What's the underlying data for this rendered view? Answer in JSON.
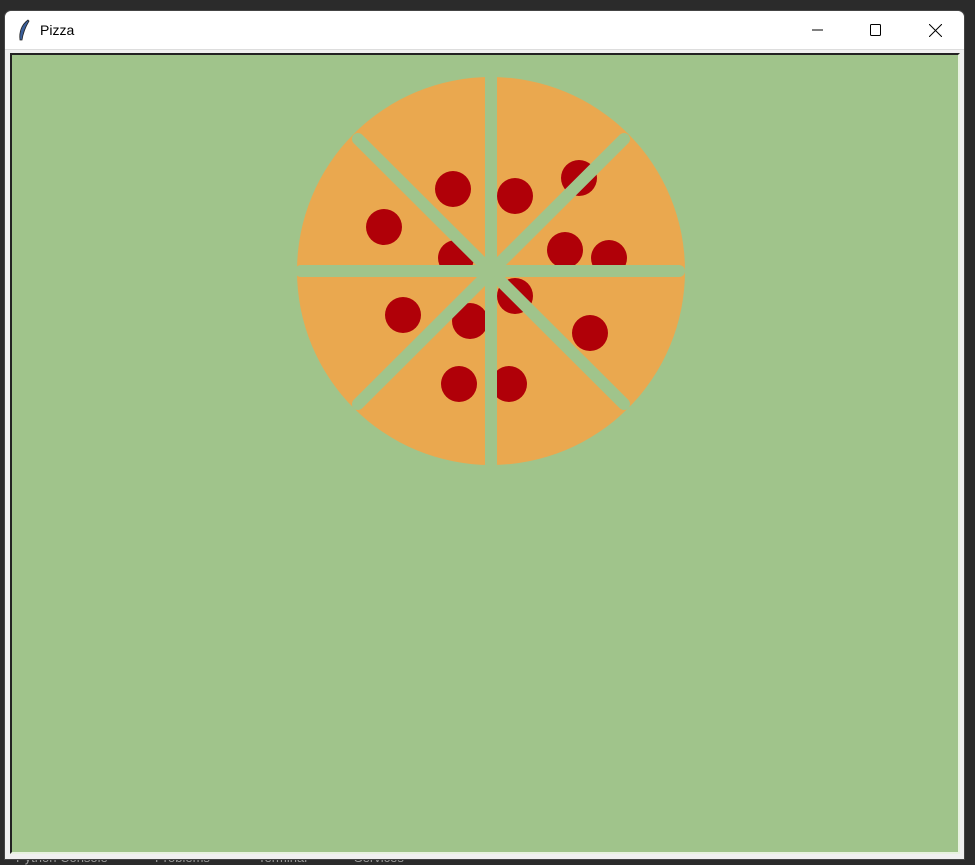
{
  "window": {
    "title": "Pizza",
    "app_icon": "tk-feather-icon"
  },
  "controls": {
    "minimize": "minimize-icon",
    "maximize": "maximize-icon",
    "close": "close-icon"
  },
  "ide_tabs": [
    "Python Console",
    "Problems",
    "Terminal",
    "Services"
  ],
  "colors": {
    "background": "#a0c48b",
    "crust": "#eaa84f",
    "pepperoni": "#b00008",
    "cuts": "#a0c48b"
  },
  "pizza": {
    "slices": 8,
    "pepperoni_count": 13
  }
}
